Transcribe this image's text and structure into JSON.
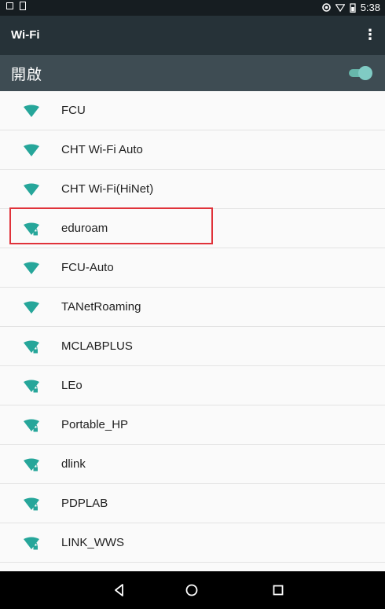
{
  "status_bar": {
    "time": "5:38",
    "icons": [
      "screenshot-icon",
      "sim-icon",
      "alarm-icon",
      "wifi-status-icon",
      "battery-icon"
    ]
  },
  "app_bar": {
    "title": "Wi-Fi",
    "menu_icon": "more-vert-icon"
  },
  "wifi_switch": {
    "label": "開啟",
    "state": "on"
  },
  "networks": [
    {
      "name": "FCU",
      "secured": false
    },
    {
      "name": "CHT Wi-Fi Auto",
      "secured": false
    },
    {
      "name": "CHT Wi-Fi(HiNet)",
      "secured": false
    },
    {
      "name": "eduroam",
      "secured": true,
      "highlighted": true
    },
    {
      "name": "FCU-Auto",
      "secured": false
    },
    {
      "name": "TANetRoaming",
      "secured": false
    },
    {
      "name": "MCLABPLUS",
      "secured": true
    },
    {
      "name": "LEo",
      "secured": true
    },
    {
      "name": "Portable_HP",
      "secured": true
    },
    {
      "name": "dlink",
      "secured": true
    },
    {
      "name": "PDPLAB",
      "secured": true
    },
    {
      "name": "LINK_WWS",
      "secured": true
    }
  ],
  "nav_bar": {
    "buttons": [
      "back-icon",
      "home-icon",
      "recents-icon"
    ]
  },
  "colors": {
    "app_bar": "#263238",
    "switch_bar": "#3e4c53",
    "accent": "#26a69a",
    "highlight": "#e0323a"
  }
}
